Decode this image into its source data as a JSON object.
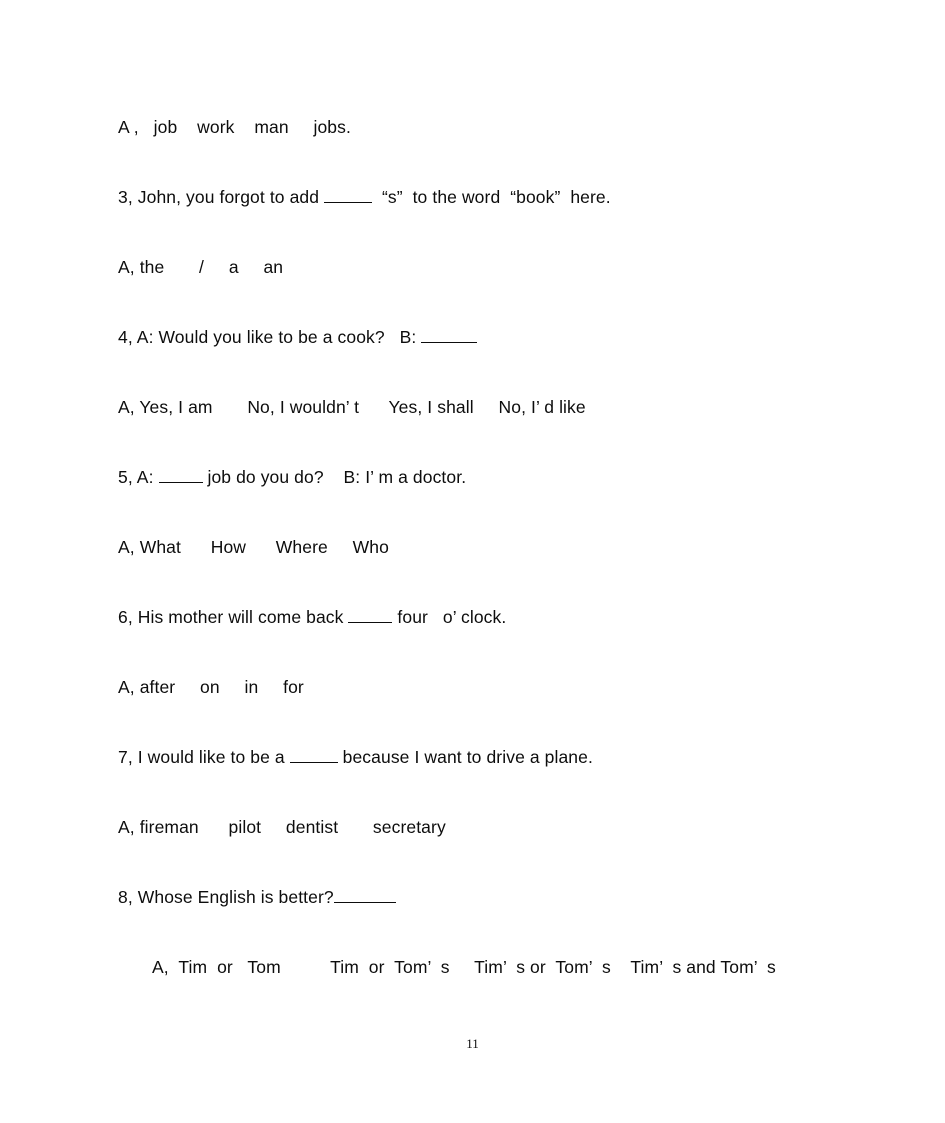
{
  "document": {
    "page_number": "11",
    "lines": [
      {
        "id": "answer-2",
        "kind": "answer",
        "text": "A ,   job    work    man     jobs."
      },
      {
        "id": "question-3",
        "kind": "question",
        "pre": "3, John, you forgot to add ",
        "post": "  “s”  to the word  “book”  here.",
        "blank": "w-med2"
      },
      {
        "id": "answer-3",
        "kind": "answer",
        "text": "A, the       /     a     an"
      },
      {
        "id": "question-4",
        "kind": "question",
        "pre": "4, A: Would you like to be a cook?   B: ",
        "post": "",
        "blank": "w-large"
      },
      {
        "id": "answer-4",
        "kind": "answer",
        "text": "A, Yes, I am       No, I wouldn’ t      Yes, I shall     No, I’ d like"
      },
      {
        "id": "question-5",
        "kind": "question",
        "pre": "5, A: ",
        "post": " job do you do?    B: I’ m a doctor.",
        "blank": "w-med"
      },
      {
        "id": "answer-5",
        "kind": "answer",
        "text": "A, What      How      Where     Who"
      },
      {
        "id": "question-6",
        "kind": "question",
        "pre": "6, His mother will come back ",
        "post": " four   o’ clock.",
        "blank": "w-med"
      },
      {
        "id": "answer-6",
        "kind": "answer",
        "text": "A, after     on     in     for"
      },
      {
        "id": "question-7",
        "kind": "question",
        "pre": "7, I would like to be a ",
        "post": " because I want to drive a plane.",
        "blank": "w-med2"
      },
      {
        "id": "answer-7",
        "kind": "answer",
        "text": "A, fireman      pilot     dentist       secretary"
      },
      {
        "id": "question-8",
        "kind": "question",
        "pre": "8, Whose English is better?",
        "post": "",
        "blank": "w-xl"
      }
    ],
    "final_answer": {
      "id": "answer-8",
      "text": "A,  Tim  or   Tom          Tim  or  Tom’  s     Tim’  s or  Tom’  s    Tim’  s and Tom’  s"
    }
  }
}
